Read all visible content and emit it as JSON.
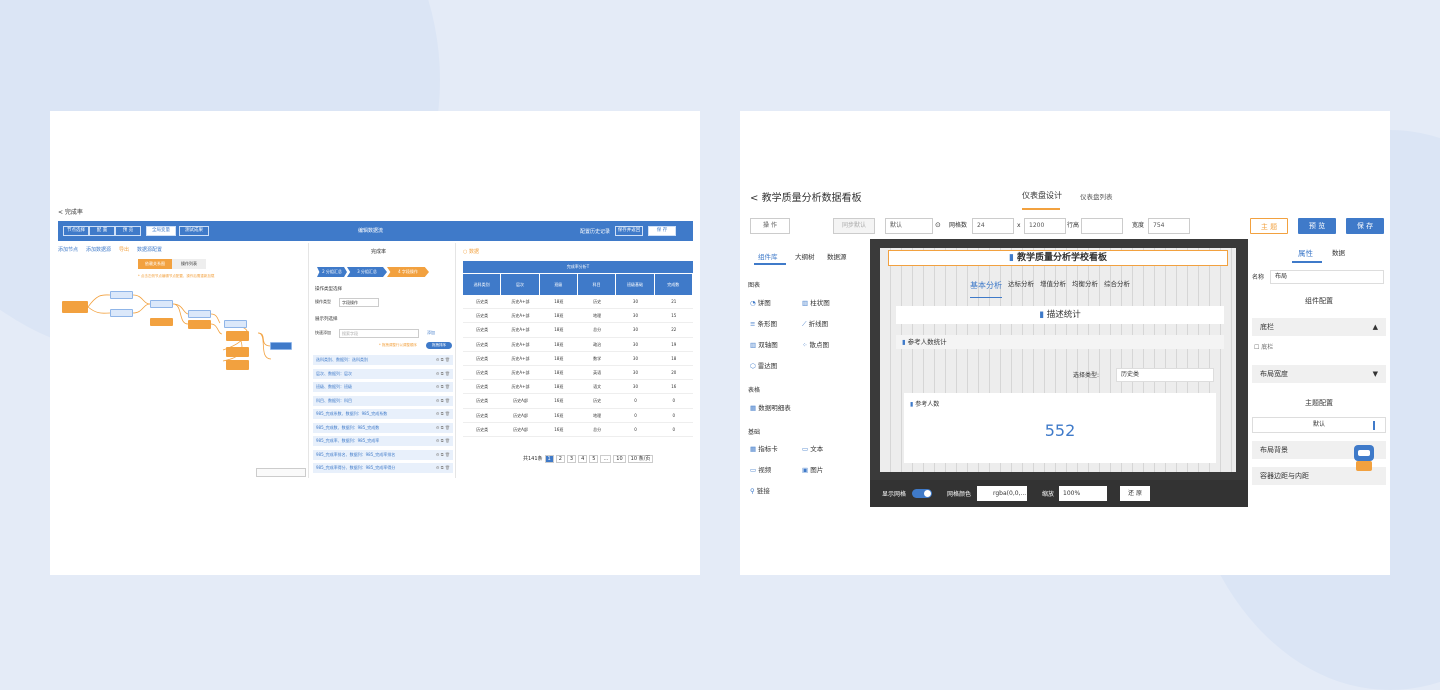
{
  "left": {
    "back": "< 完成率",
    "toolbar": {
      "buttons": [
        "节点选择",
        "配 置",
        "预 览",
        "全局变量",
        "测试成果"
      ],
      "title": "编辑数据流",
      "right_text": "配置历史记录",
      "btn1": "保存并返回",
      "btn2": "保 存"
    },
    "links": [
      "添加节点",
      "添加数据源",
      "导出",
      "数据源配置"
    ],
    "toggle": [
      "依赖关系图",
      "操作列表"
    ],
    "hint": "* 点击左侧节点编辑节点配置，操作后需重新加载",
    "mid_title": "完成率",
    "steps": [
      "2 分组汇总",
      "3 分组汇总",
      "4 字段操作"
    ],
    "op_title": "操作类型选择",
    "op_label": "操作类型",
    "op_value": "字段操作",
    "col_title": "展示列选择",
    "quick": "快速添加",
    "search_ph": "搜索字段",
    "add": "添加",
    "note": "* 拖拽调整行以调整顺序",
    "toggle_label": "拖拽排序",
    "rows": [
      "选科类别、数据列：选科类别",
      "层次、数据列：层次",
      "班级、数据列：班级",
      "科目、数据列：科目",
      "985_完成系数、数据列：985_完成系数",
      "985_完成数、数据列：985_完成数",
      "985_完成率、数据列：985_完成率",
      "985_完成率排名、数据列：985_完成率排名",
      "985_完成率得分、数据列：985_完成率得分"
    ],
    "table": {
      "title": "完成率分析T",
      "cols": [
        "选科类别",
        "层次",
        "班级",
        "科目",
        "班级基础",
        "完成数"
      ],
      "rows": [
        [
          "历史类",
          "历史A+部",
          "18班",
          "历史",
          "30",
          "21"
        ],
        [
          "历史类",
          "历史A+部",
          "18班",
          "地理",
          "30",
          "15"
        ],
        [
          "历史类",
          "历史A+部",
          "18班",
          "总分",
          "30",
          "22"
        ],
        [
          "历史类",
          "历史A+部",
          "18班",
          "政治",
          "30",
          "19"
        ],
        [
          "历史类",
          "历史A+部",
          "18班",
          "数学",
          "30",
          "18"
        ],
        [
          "历史类",
          "历史A+部",
          "18班",
          "英语",
          "30",
          "20"
        ],
        [
          "历史类",
          "历史A+部",
          "18班",
          "语文",
          "30",
          "16"
        ],
        [
          "历史类",
          "历史A部",
          "16班",
          "历史",
          "0",
          "0"
        ],
        [
          "历史类",
          "历史A部",
          "16班",
          "地理",
          "0",
          "0"
        ],
        [
          "历史类",
          "历史A部",
          "16班",
          "总分",
          "0",
          "0"
        ]
      ],
      "total": "共141条",
      "pages": [
        "1",
        "2",
        "3",
        "4",
        "5",
        "...",
        "10"
      ],
      "per": "10 条/页"
    }
  },
  "right": {
    "back": "<",
    "title": "教学质量分析数据看板",
    "tabs": [
      "仪表盘设计",
      "仪表盘列表"
    ],
    "toolbar": {
      "op": "操 作",
      "sync": "同步默认",
      "def": "默认",
      "grid_label": "网格数",
      "grid_val": "24",
      "x": "x",
      "width_val": "1200",
      "row_label": "行高",
      "width_label": "宽度",
      "width2": "754",
      "theme": "主 题",
      "preview": "预 览",
      "save": "保 存"
    },
    "lib_tabs": [
      "组件库",
      "大纲树",
      "数据源"
    ],
    "sections": [
      "图表",
      "表格",
      "基础"
    ],
    "charts": [
      "饼图",
      "柱状图",
      "条形图",
      "折线图",
      "双轴图",
      "散点图",
      "雷达图"
    ],
    "tables": [
      "数据明细表"
    ],
    "basics": [
      "指标卡",
      "文本",
      "视频",
      "图片",
      "链接"
    ],
    "canvas": {
      "title": "教学质量分析学校看板",
      "subtabs": [
        "基本分析",
        "达标分析",
        "增值分析",
        "均衡分析",
        "综合分析"
      ],
      "section": "描述统计",
      "sub": "参考人数统计",
      "filter_label": "选择类型:",
      "filter_val": "历史类",
      "card_title": "参考人数",
      "card_value": "552"
    },
    "footer": {
      "grid": "显示网格",
      "color_label": "网格颜色",
      "color_val": "rgba(0,0,...",
      "zoom_label": "缩放",
      "zoom": "100%",
      "restore": "还 原"
    },
    "props": {
      "tabs": [
        "属性",
        "数据"
      ],
      "name_label": "名称",
      "name_val": "布局",
      "group1": "组件配置",
      "item1": "底栏",
      "chk": "底栏",
      "item2": "布局宽度",
      "group2": "主题配置",
      "def": "默认",
      "item3": "布局背景",
      "item4": "容器边距与内距"
    }
  }
}
